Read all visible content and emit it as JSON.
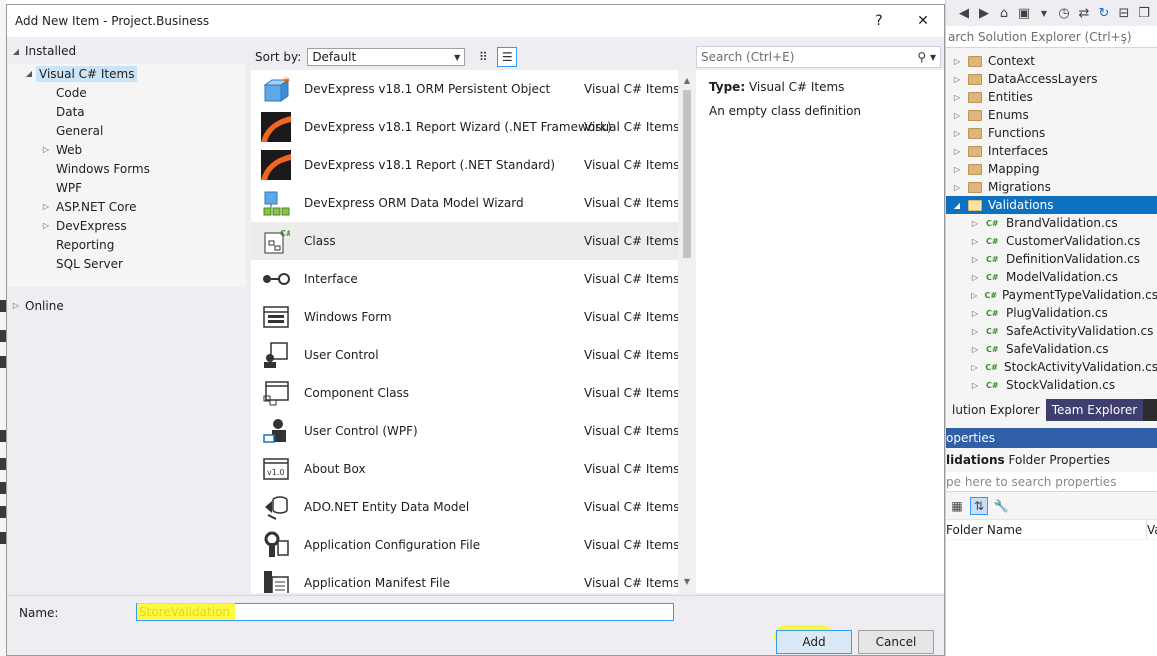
{
  "dialog": {
    "title": "Add New Item - Project.Business",
    "help_glyph": "?",
    "close_glyph": "✕"
  },
  "categories": {
    "installed": "Installed",
    "items": [
      {
        "label": "Visual C# Items",
        "expander": "◢"
      },
      {
        "label": "Code",
        "expander": ""
      },
      {
        "label": "Data",
        "expander": ""
      },
      {
        "label": "General",
        "expander": ""
      },
      {
        "label": "Web",
        "expander": "▷"
      },
      {
        "label": "Windows Forms",
        "expander": ""
      },
      {
        "label": "WPF",
        "expander": ""
      },
      {
        "label": "ASP.NET Core",
        "expander": "▷"
      },
      {
        "label": "DevExpress",
        "expander": "▷"
      },
      {
        "label": "Reporting",
        "expander": ""
      },
      {
        "label": "SQL Server",
        "expander": ""
      }
    ],
    "online": "Online"
  },
  "sort": {
    "label": "Sort by:",
    "value": "Default"
  },
  "search": {
    "placeholder": "Search (Ctrl+E)"
  },
  "templates": [
    {
      "name": "DevExpress v18.1 ORM Persistent Object",
      "type": "Visual C# Items",
      "icon": "orm-object-icon"
    },
    {
      "name": "DevExpress v18.1 Report Wizard (.NET Framework)",
      "type": "Visual C# Items",
      "icon": "report-wizard-icon"
    },
    {
      "name": "DevExpress v18.1 Report (.NET Standard)",
      "type": "Visual C# Items",
      "icon": "report-icon"
    },
    {
      "name": "DevExpress ORM Data Model Wizard",
      "type": "Visual C# Items",
      "icon": "orm-data-model-icon"
    },
    {
      "name": "Class",
      "type": "Visual C# Items",
      "icon": "class-icon"
    },
    {
      "name": "Interface",
      "type": "Visual C# Items",
      "icon": "interface-icon"
    },
    {
      "name": "Windows Form",
      "type": "Visual C# Items",
      "icon": "windows-form-icon"
    },
    {
      "name": "User Control",
      "type": "Visual C# Items",
      "icon": "user-control-icon"
    },
    {
      "name": "Component Class",
      "type": "Visual C# Items",
      "icon": "component-class-icon"
    },
    {
      "name": "User Control (WPF)",
      "type": "Visual C# Items",
      "icon": "user-control-wpf-icon"
    },
    {
      "name": "About Box",
      "type": "Visual C# Items",
      "icon": "about-box-icon"
    },
    {
      "name": "ADO.NET Entity Data Model",
      "type": "Visual C# Items",
      "icon": "entity-data-model-icon"
    },
    {
      "name": "Application Configuration File",
      "type": "Visual C# Items",
      "icon": "config-file-icon"
    },
    {
      "name": "Application Manifest File",
      "type": "Visual C# Items",
      "icon": "manifest-file-icon"
    }
  ],
  "info": {
    "type_label": "Type:",
    "type_value": "Visual C# Items",
    "description": "An empty class definition"
  },
  "name_field": {
    "label": "Name:",
    "value": "StoreValidation"
  },
  "buttons": {
    "add": "Add",
    "cancel": "Cancel"
  },
  "solution_explorer": {
    "search_placeholder": "arch Solution Explorer (Ctrl+ş)",
    "folders": [
      "Context",
      "DataAccessLayers",
      "Entities",
      "Enums",
      "Functions",
      "Interfaces",
      "Mapping",
      "Migrations",
      "Validations"
    ],
    "files": [
      "BrandValidation.cs",
      "CustomerValidation.cs",
      "DefinitionValidation.cs",
      "ModelValidation.cs",
      "PaymentTypeValidation.cs",
      "PlugValidation.cs",
      "SafeActivityValidation.cs",
      "SafeValidation.cs",
      "StockActivityValidation.cs",
      "StockValidation.cs"
    ],
    "cs_badge": "C#",
    "tabs": [
      "lution Explorer",
      "Team Explorer"
    ]
  },
  "properties": {
    "header": "operties",
    "subject": "lidations",
    "subject_suffix": " Folder Properties",
    "search_placeholder": "pe here to search properties",
    "row_key": "Folder Name",
    "row_value": "Va"
  }
}
